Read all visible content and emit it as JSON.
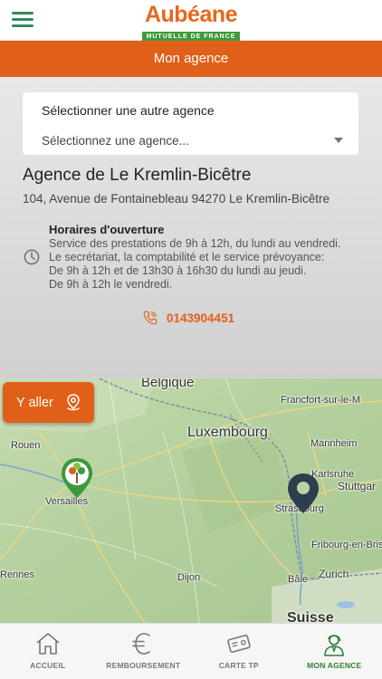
{
  "header": {
    "logo_name": "Aubéane",
    "logo_tagline": "MUTUELLE DE FRANCE",
    "title": "Mon agence"
  },
  "agency_selector": {
    "label": "Sélectionner une autre agence",
    "placeholder": "Sélectionnez une agence..."
  },
  "agency": {
    "name": "Agence de Le Kremlin-Bicêtre",
    "address": "104, Avenue de Fontainebleau 94270 Le Kremlin-Bicêtre",
    "hours_title": "Horaires d'ouverture",
    "hours_lines": [
      "Service des prestations de 9h à 12h, du lundi au vendredi.",
      "Le secrétariat, la comptabilité et le service prévoyance:",
      "De 9h à 12h et de 13h30 à 16h30 du lundi au jeudi.",
      "De 9h à 12h le vendredi."
    ],
    "phone": "0143904451"
  },
  "map": {
    "goto_label": "Y aller",
    "labels": {
      "belgique": "Belgique",
      "francfort": "Francfort-sur-le-M",
      "luxembourg": "Luxembourg",
      "rouen": "Rouen",
      "mannheim": "Mannheim",
      "karlsruhe": "Karlsruhe",
      "stuttgart": "Stuttgar",
      "versailles": "Versailles",
      "strasbourg": "Strasbourg",
      "fribourg": "Fribourg-en-Bris",
      "rennes": "Rennes",
      "dijon": "Dijon",
      "bale": "Bâle",
      "zurich": "Zurich",
      "suisse": "Suisse"
    }
  },
  "nav": {
    "items": [
      {
        "label": "ACCUEIL",
        "icon": "home-icon"
      },
      {
        "label": "REMBOURSEMENT",
        "icon": "euro-icon"
      },
      {
        "label": "CARTE TP",
        "icon": "card-icon"
      },
      {
        "label": "MON AGENCE",
        "icon": "agent-icon"
      }
    ]
  },
  "colors": {
    "accent_orange": "#e0601a",
    "brand_green": "#2e8b57",
    "map_pin_dark": "#2f3e4e"
  }
}
